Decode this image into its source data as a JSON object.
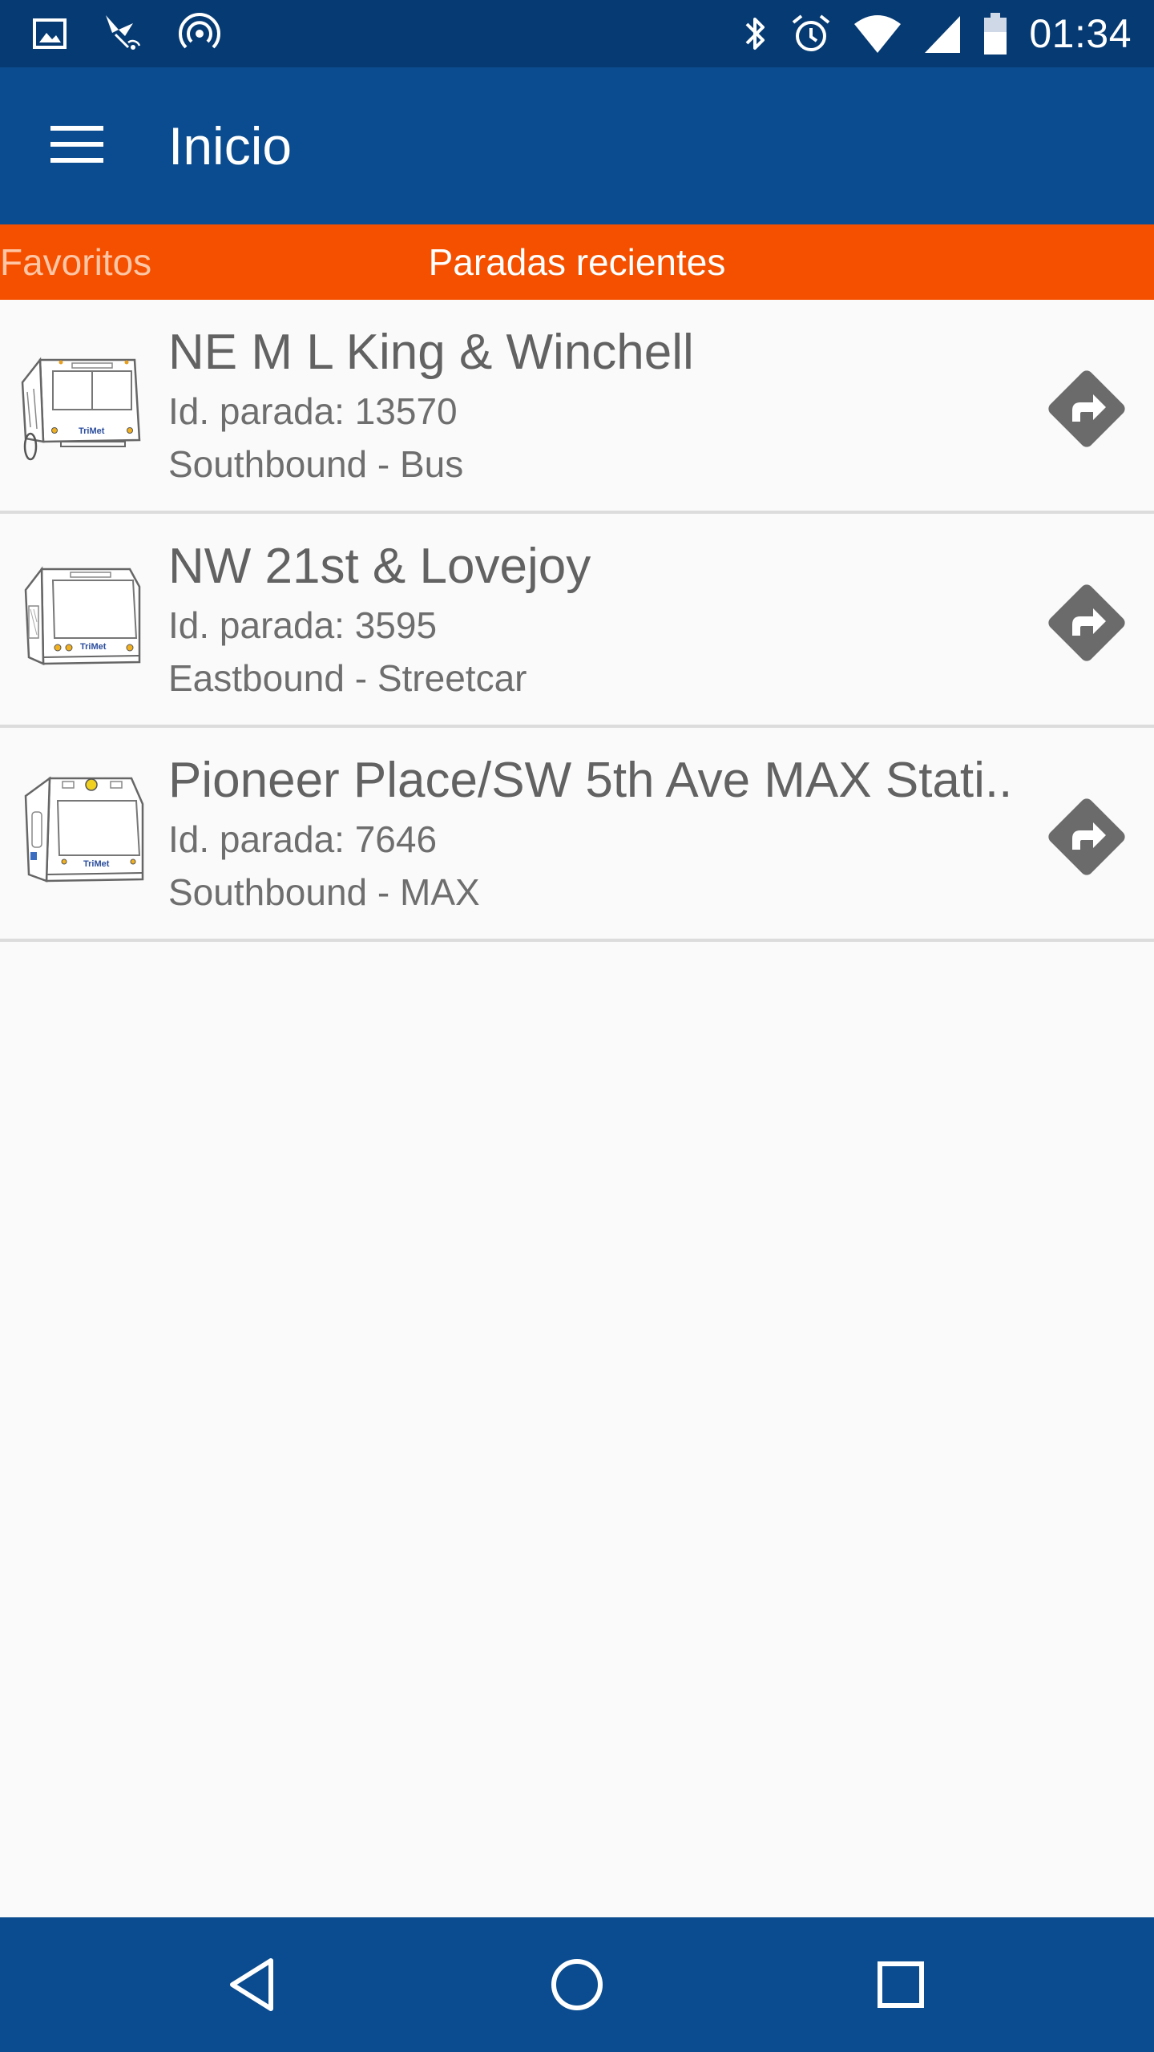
{
  "status_bar": {
    "time": "01:34",
    "left_icons": [
      "image-icon",
      "satellite-icon",
      "hotspot-icon"
    ],
    "right_icons": [
      "bluetooth-icon",
      "alarm-icon",
      "wifi-icon",
      "signal-icon",
      "battery-icon"
    ]
  },
  "app_bar": {
    "title": "Inicio",
    "menu_icon": "hamburger-menu-icon"
  },
  "tabs": [
    {
      "label": "Favoritos",
      "selected": false
    },
    {
      "label": "Paradas recientes",
      "selected": true
    }
  ],
  "stops": [
    {
      "name": "NE M L King & Winchell",
      "id_line": "Id. parada: 13570",
      "direction_line": "Southbound - Bus",
      "vehicle_icon": "bus-icon"
    },
    {
      "name": "NW 21st & Lovejoy",
      "id_line": "Id. parada: 3595",
      "direction_line": "Eastbound - Streetcar",
      "vehicle_icon": "streetcar-icon"
    },
    {
      "name": "Pioneer Place/SW 5th Ave MAX Stati..",
      "id_line": "Id. parada: 7646",
      "direction_line": "Southbound - MAX",
      "vehicle_icon": "max-train-icon"
    }
  ],
  "colors": {
    "status_bar": "#063a73",
    "app_bar": "#0a4c8f",
    "tab_strip": "#f55000",
    "list_bg": "#fafafa",
    "directions_icon": "#6b6b6b"
  },
  "nav_bar": {
    "icons": [
      "back-icon",
      "home-icon",
      "recents-icon"
    ]
  }
}
